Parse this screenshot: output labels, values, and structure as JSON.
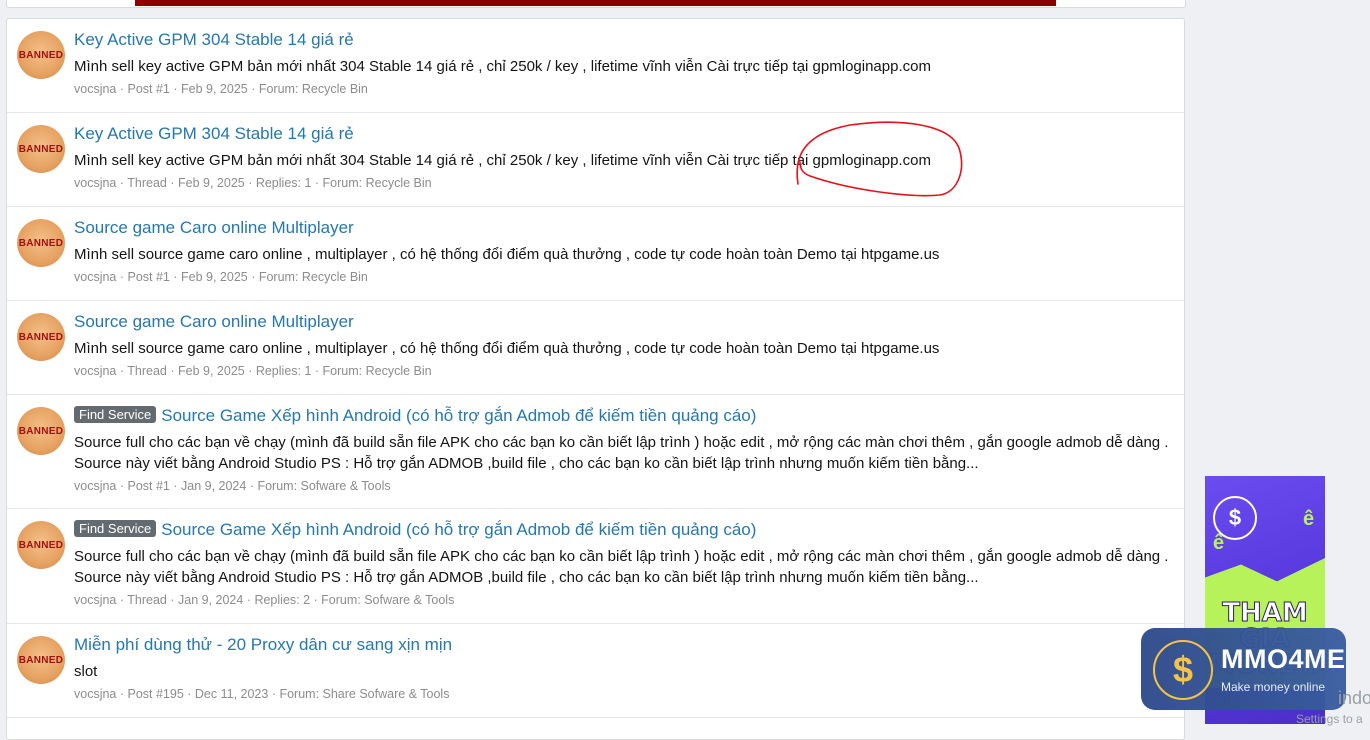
{
  "results": [
    {
      "avatar_text": "BANNED",
      "badge": "",
      "title": "Key Active GPM 304 Stable 14 giá rẻ",
      "snippet": [
        "Mình sell key active GPM bản mới nhất 304 Stable 14 giá rẻ , chỉ 250k / key , lifetime vĩnh viễn Cài trực tiếp tại gpmloginapp.com"
      ],
      "user": "vocsjna",
      "type": "Post #1",
      "date": "Feb 9, 2025",
      "replies": "",
      "forum": "Recycle Bin"
    },
    {
      "avatar_text": "BANNED",
      "badge": "",
      "title": "Key Active GPM 304 Stable 14 giá rẻ",
      "snippet": [
        "Mình sell key active GPM bản mới nhất 304 Stable 14 giá rẻ , chỉ 250k / key , lifetime vĩnh viễn Cài trực tiếp tại gpmloginapp.com"
      ],
      "user": "vocsjna",
      "type": "Thread",
      "date": "Feb 9, 2025",
      "replies": "Replies: 1",
      "forum": "Recycle Bin"
    },
    {
      "avatar_text": "BANNED",
      "badge": "",
      "title": "Source game Caro online Multiplayer",
      "snippet": [
        "Mình sell source game caro online , multiplayer , có hệ thống đổi điểm quà thưởng , code tự code hoàn toàn Demo tại htpgame.us"
      ],
      "user": "vocsjna",
      "type": "Post #1",
      "date": "Feb 9, 2025",
      "replies": "",
      "forum": "Recycle Bin"
    },
    {
      "avatar_text": "BANNED",
      "badge": "",
      "title": "Source game Caro online Multiplayer",
      "snippet": [
        "Mình sell source game caro online , multiplayer , có hệ thống đổi điểm quà thưởng , code tự code hoàn toàn Demo tại htpgame.us"
      ],
      "user": "vocsjna",
      "type": "Thread",
      "date": "Feb 9, 2025",
      "replies": "Replies: 1",
      "forum": "Recycle Bin"
    },
    {
      "avatar_text": "BANNED",
      "badge": "Find Service",
      "title": "Source Game Xếp hình Android (có hỗ trợ gắn Admob để kiếm tiền quảng cáo)",
      "snippet": [
        "Source full cho các bạn về chạy (mình đã build sẵn file APK cho các bạn ko cần biết lập trình ) hoặc edit , mở rộng các màn chơi thêm , gắn google admob dễ dàng .",
        "Source này viết bằng Android Studio PS : Hỗ trợ gắn ADMOB ,build file , cho các bạn ko cần biết lập trình nhưng muốn kiếm tiền bằng..."
      ],
      "user": "vocsjna",
      "type": "Post #1",
      "date": "Jan 9, 2024",
      "replies": "",
      "forum": "Sofware & Tools"
    },
    {
      "avatar_text": "BANNED",
      "badge": "Find Service",
      "title": "Source Game Xếp hình Android (có hỗ trợ gắn Admob để kiếm tiền quảng cáo)",
      "snippet": [
        "Source full cho các bạn về chạy (mình đã build sẵn file APK cho các bạn ko cần biết lập trình ) hoặc edit , mở rộng các màn chơi thêm , gắn google admob dễ dàng .",
        "Source này viết bằng Android Studio PS : Hỗ trợ gắn ADMOB ,build file , cho các bạn ko cần biết lập trình nhưng muốn kiếm tiền bằng..."
      ],
      "user": "vocsjna",
      "type": "Thread",
      "date": "Jan 9, 2024",
      "replies": "Replies: 2",
      "forum": "Sofware & Tools"
    },
    {
      "avatar_text": "BANNED",
      "badge": "",
      "title": "Miễn phí dùng thử - 20 Proxy dân cư sang xịn mịn",
      "snippet": [
        "slot"
      ],
      "user": "vocsjna",
      "type": "Post #195",
      "date": "Dec 11, 2023",
      "replies": "",
      "forum": "Share Sofware & Tools"
    }
  ],
  "meta_separator": "·",
  "forum_prefix": "Forum: ",
  "ad": {
    "headline": "THAM GIA MONETAG",
    "coin_symbol": "$",
    "e_symbol": "ê"
  },
  "mmo": {
    "name": "MMO4ME",
    "tagline": "Make money online",
    "symbol": "$"
  },
  "watermark": {
    "line1": "indo",
    "line2": "Settings to a"
  },
  "colors": {
    "link": "#2577b1",
    "annotation": "#e8101a",
    "top_strip": "#8b0000",
    "badge": "#646b70"
  }
}
